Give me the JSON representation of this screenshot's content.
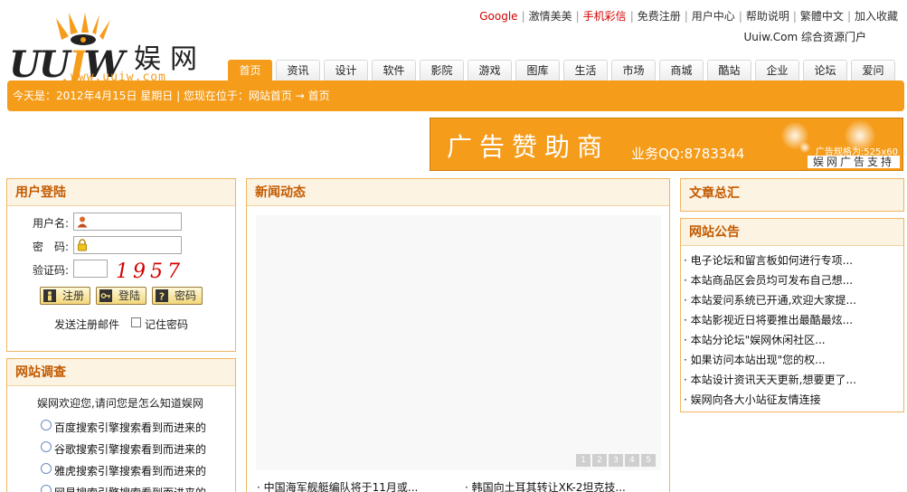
{
  "header": {
    "logo_word_left": "UU",
    "logo_word_mid": "J",
    "logo_word_right": "W",
    "logo_cn": "娱网",
    "logo_url": "www.uuiw.com",
    "slogan": "Uuiw.Com 综合资源门户",
    "top_links": [
      {
        "label": "Google",
        "red": true
      },
      {
        "label": "激情美美",
        "red": false
      },
      {
        "label": "手机彩信",
        "red": true
      },
      {
        "label": "免费注册",
        "red": false
      },
      {
        "label": "用户中心",
        "red": false
      },
      {
        "label": "帮助说明",
        "red": false
      },
      {
        "label": "繁體中文",
        "red": false
      },
      {
        "label": "加入收藏",
        "red": false
      }
    ],
    "tabs": [
      "首页",
      "资讯",
      "设计",
      "软件",
      "影院",
      "游戏",
      "图库",
      "生活",
      "市场",
      "商城",
      "酷站",
      "企业",
      "论坛",
      "爱问"
    ]
  },
  "nav_bar": {
    "text": "今天是：2012年4月15日 星期日 | 您现在位于：网站首页 → 首页"
  },
  "ad": {
    "title": "广告赞助商",
    "qq": "业务QQ:8783344",
    "spec": "广告规格为:525x60",
    "footer": "娱网广告支持"
  },
  "login": {
    "title": "用户登陆",
    "username_label": "用户名:",
    "password_label": "密　码:",
    "captcha_label": "验证码:",
    "captcha_value": "1957",
    "register_btn": "注册",
    "login_btn": "登陆",
    "password_btn": "密码",
    "send_mail": "发送注册邮件",
    "remember": "记住密码"
  },
  "survey": {
    "title": "网站调查",
    "question": "娱网欢迎您,请问您是怎么知道娱网",
    "options": [
      "百度搜索引擎搜索看到而进来的",
      "谷歌搜索引擎搜索看到而进来的",
      "雅虎搜索引擎搜索看到而进来的",
      "网易搜索引擎搜索看到而进来的"
    ]
  },
  "news": {
    "title": "新闻动态",
    "pages": [
      "1",
      "2",
      "3",
      "4",
      "5"
    ],
    "headlines": [
      "· 中国海军舰艇编队将于11月或...",
      "· 韩国向土耳其转让XK-2坦克技..."
    ]
  },
  "articles": {
    "title": "文章总汇"
  },
  "notice": {
    "title": "网站公告",
    "items": [
      "· 电子论坛和留言板如何进行专项...",
      "· 本站商品区会员均可发布自己想...",
      "· 本站爱问系统已开通,欢迎大家提...",
      "· 本站影视近日将要推出最酷最炫...",
      "· 本站分论坛\"娱网休闲社区...",
      "· 如果访问本站出现\"您的权...",
      "· 本站设计资讯天天更新,想要更了...",
      "· 娱网向各大小站征友情连接"
    ]
  },
  "colors": {
    "brand_orange": "#f59c1a",
    "link_red": "#d40000",
    "panel_title": "#c25a00"
  }
}
